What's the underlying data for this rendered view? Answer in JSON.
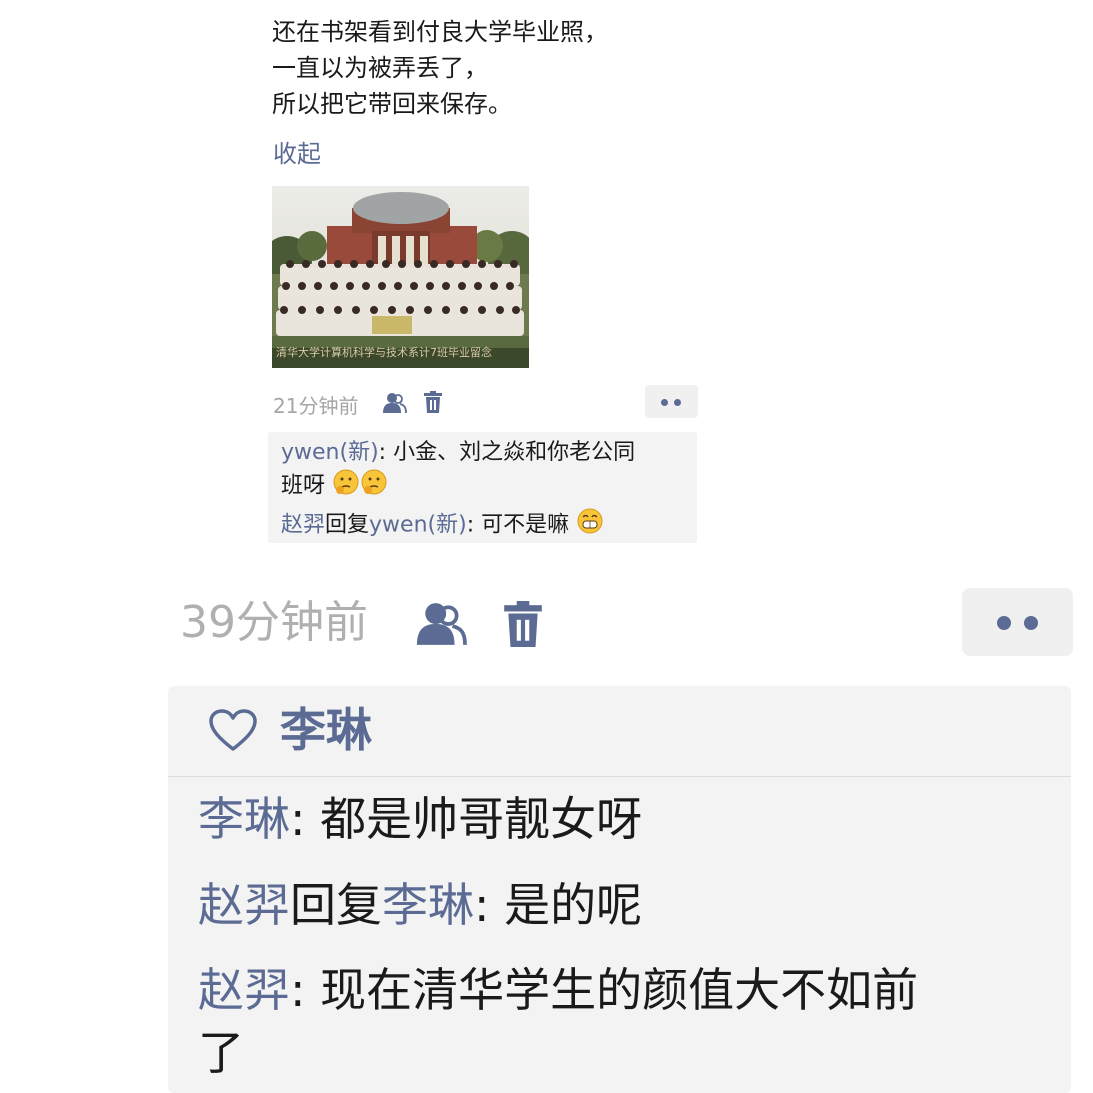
{
  "post": {
    "text_lines": [
      "还在书架看到付良大学毕业照，",
      "一直以为被弄丢了，",
      "所以把它带回来保存。"
    ],
    "collapse_label": "收起",
    "photo_caption": "清华大学计算机科学与技术系计7班毕业留念"
  },
  "previous_post": {
    "time": "21分钟前",
    "comments": [
      {
        "name": "ywen(新)",
        "sep": ": ",
        "text_line1": "小金、刘之焱和你老公同",
        "text_line2": "班呀"
      },
      {
        "name": "赵羿",
        "reply_word": "回复",
        "reply_to": "ywen(新)",
        "sep": ": ",
        "text": "可不是嘛"
      }
    ]
  },
  "current_post": {
    "time": "39分钟前",
    "likes": [
      "李琳"
    ],
    "comments": [
      {
        "name": "李琳",
        "sep": ": ",
        "text": "都是帅哥靓女呀"
      },
      {
        "name": "赵羿",
        "reply_word": "回复",
        "reply_to": "李琳",
        "sep": ": ",
        "text": "是的呢"
      },
      {
        "name": "赵羿",
        "sep": ": ",
        "text_line1": "现在清华学生的颜值大不如前",
        "text_line2": "了"
      }
    ]
  },
  "colors": {
    "link": "#5b6b93",
    "time": "#a5a5a5",
    "comment_bg": "#f3f3f3",
    "text": "#1a1a1a"
  },
  "icons": [
    "visibility-icon",
    "delete-icon",
    "more-icon",
    "heart-icon",
    "thinking-emoji",
    "grin-emoji"
  ]
}
